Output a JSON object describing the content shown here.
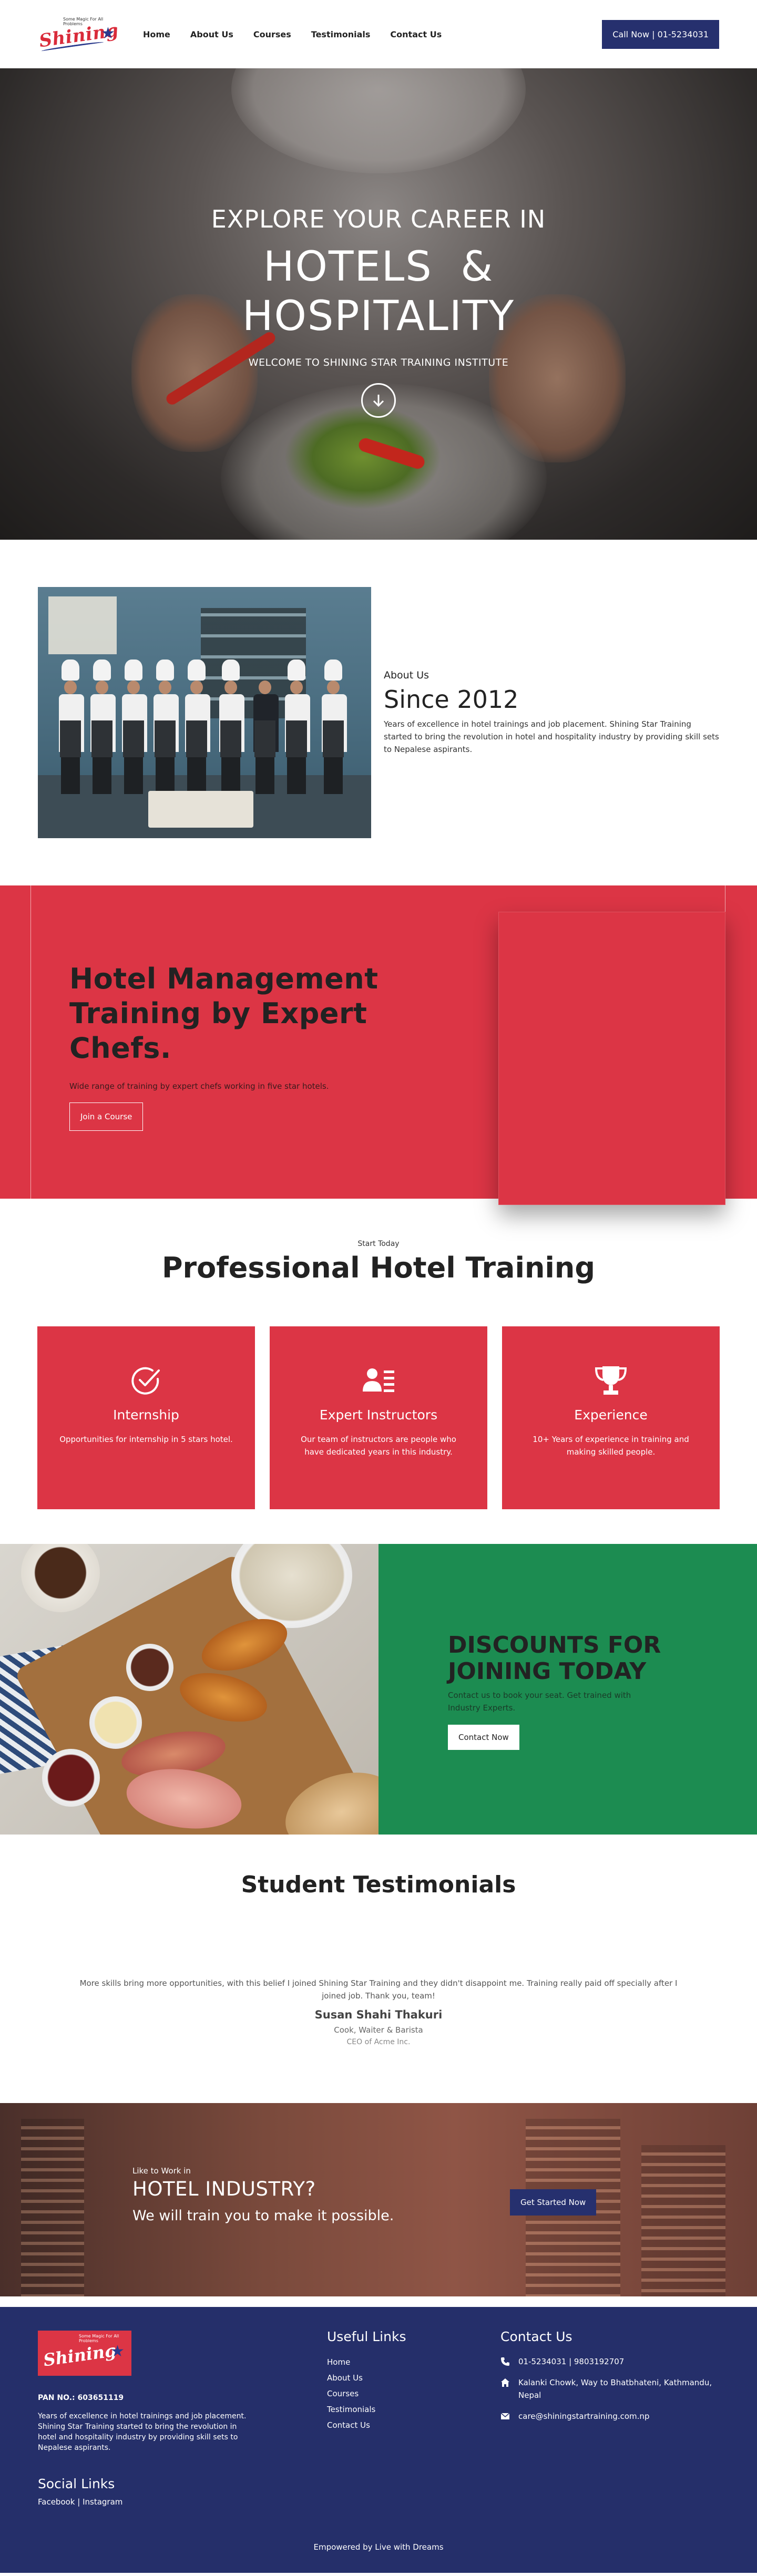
{
  "header": {
    "logo": {
      "tagline": "Some Magic For All Problems",
      "word": "Shining"
    },
    "nav": [
      "Home",
      "About Us",
      "Courses",
      "Testimonials",
      "Contact Us"
    ],
    "call_button": "Call Now | 01-5234031",
    "colors": {
      "accent": "#26306e",
      "brand": "#dc3545"
    }
  },
  "hero": {
    "line1": "EXPLORE YOUR CAREER IN",
    "line2a": "HOTELS  &",
    "line2b": "HOSPITALITY",
    "line3": "WELCOME TO SHINING STAR TRAINING INSTITUTE",
    "scroll_icon": "arrow-down-circle-icon"
  },
  "about": {
    "label": "About Us",
    "since": "Since 2012",
    "description": "Years of excellence in hotel trainings and job placement. Shining Star Training started to bring the revolution in hotel and hospitality industry by providing skill sets to Nepalese aspirants."
  },
  "management": {
    "title": "Hotel Management Training by Expert Chefs.",
    "subtitle": "Wide range of training by expert chefs working in five star hotels.",
    "button": "Join a Course"
  },
  "training": {
    "small": "Start Today",
    "title": "Professional Hotel Training",
    "cards": [
      {
        "icon": "check-circle-icon",
        "title": "Internship",
        "desc": "Opportunities for internship in 5 stars hotel."
      },
      {
        "icon": "instructor-icon",
        "title": "Expert Instructors",
        "desc": "Our team of instructors are people who have dedicated years in this industry."
      },
      {
        "icon": "trophy-icon",
        "title": "Experience",
        "desc": "10+ Years of experience in training and making skilled people."
      }
    ]
  },
  "discount": {
    "title_1": "DISCOUNTS FOR",
    "title_2": "JOINING TODAY",
    "text": "Contact us to book your seat. Get trained with Industry Experts.",
    "button": "Contact Now",
    "color": "#1c8c51"
  },
  "testimonials": {
    "title": "Student Testimonials",
    "quote": "More skills bring more opportunities, with this belief I joined Shining Star Training and they didn't disappoint me. Training really paid off specially after I joined job. Thank you, team!",
    "name": "Susan Shahi Thakuri",
    "role": "Cook, Waiter & Barista",
    "org": "CEO of Acme Inc."
  },
  "industry": {
    "small": "Like to Work in",
    "big": "HOTEL INDUSTRY?",
    "line": "We will train you to make it possible.",
    "button": "Get Started Now"
  },
  "footer": {
    "pan": "PAN NO.: 603651119",
    "description": "Years of excellence in hotel trainings and job placement. Shining Star Training started to bring the revolution in hotel and hospitality industry by providing skill sets to Nepalese aspirants.",
    "social_title": "Social Links",
    "social_facebook": "Facebook",
    "social_sep": " | ",
    "social_instagram": "Instagram",
    "useful_title": "Useful Links",
    "useful_links": [
      "Home",
      "About Us",
      "Courses",
      "Testimonials",
      "Contact Us"
    ],
    "contact_title": "Contact Us",
    "phone": "01-5234031 | 9803192707",
    "address": "Kalanki Chowk, Way to Bhatbhateni, Kathmandu, Nepal",
    "email": "care@shiningstartraining.com.np",
    "bottom": "Empowered by Live with Dreams",
    "color": "#252f6a"
  }
}
